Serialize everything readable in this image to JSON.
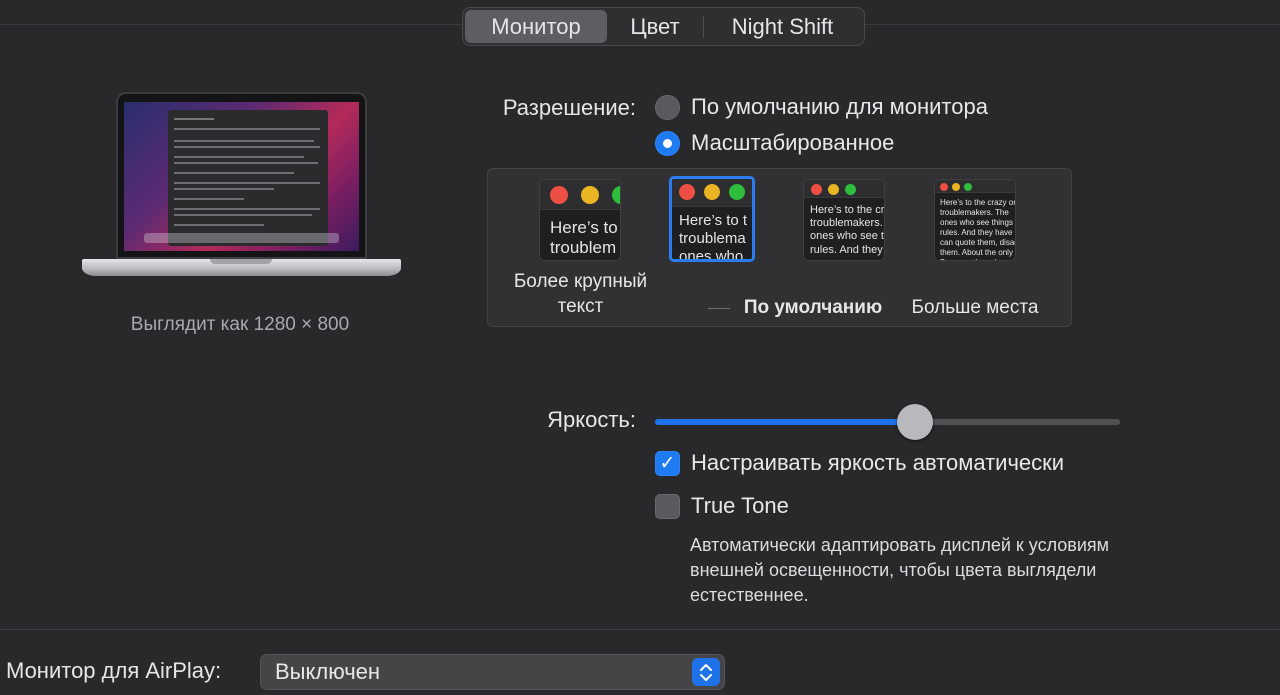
{
  "tabs": [
    {
      "label": "Монитор",
      "active": true
    },
    {
      "label": "Цвет",
      "active": false
    },
    {
      "label": "Night Shift",
      "active": false
    }
  ],
  "preview": {
    "looks_like": "Выглядит как 1280 × 800"
  },
  "resolution": {
    "label": "Разрешение:",
    "options": [
      {
        "label": "По умолчанию для монитора",
        "selected": false
      },
      {
        "label": "Масштабированное",
        "selected": true
      }
    ]
  },
  "scaling": {
    "thumbs": [
      {
        "text": "Here’s to\ntroublem",
        "selected": false
      },
      {
        "text": "Here’s to t\ntroublema\nones who",
        "selected": true
      },
      {
        "text": "Here’s to the cr\ntroublemakers.\nones who see t\nrules. And they",
        "selected": false
      },
      {
        "text": "Here’s to the crazy one\ntroublemakers. The\nones who see things di\nrules. And they have n\ncan quote them, disagr\nthem. About the only th\nBecause they change th",
        "selected": false
      }
    ],
    "labels": {
      "larger_text": "Более крупный текст",
      "default": "По умолчанию",
      "more_space": "Больше места"
    }
  },
  "brightness": {
    "label": "Яркость:",
    "value": 0.56
  },
  "auto_brightness": {
    "label": "Настраивать яркость автоматически",
    "checked": true
  },
  "true_tone": {
    "label": "True Tone",
    "checked": false,
    "description": "Автоматически адаптировать дисплей к условиям внешней освещенности, чтобы цвета выглядели естественнее."
  },
  "airplay": {
    "label": "Монитор для AirPlay:",
    "value": "Выключен"
  },
  "colors": {
    "accent": "#1f7bf2",
    "traffic_red": "#ee4f45",
    "traffic_yellow": "#e9b522",
    "traffic_green": "#2fbd3c"
  }
}
